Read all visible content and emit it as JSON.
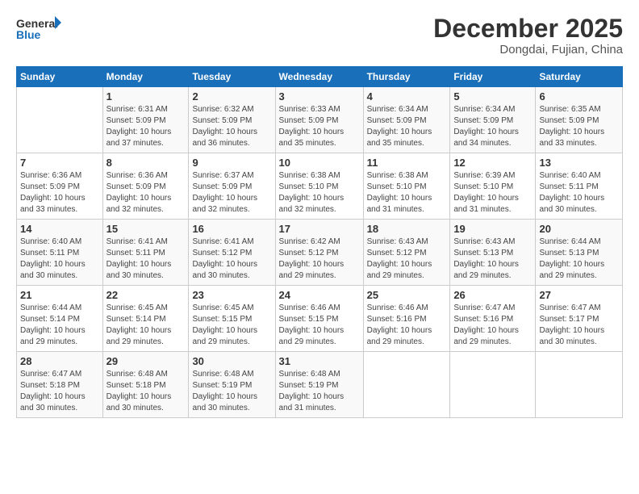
{
  "logo": {
    "line1": "General",
    "line2": "Blue"
  },
  "title": "December 2025",
  "location": "Dongdai, Fujian, China",
  "days_header": [
    "Sunday",
    "Monday",
    "Tuesday",
    "Wednesday",
    "Thursday",
    "Friday",
    "Saturday"
  ],
  "weeks": [
    [
      {
        "num": "",
        "info": ""
      },
      {
        "num": "1",
        "info": "Sunrise: 6:31 AM\nSunset: 5:09 PM\nDaylight: 10 hours\nand 37 minutes."
      },
      {
        "num": "2",
        "info": "Sunrise: 6:32 AM\nSunset: 5:09 PM\nDaylight: 10 hours\nand 36 minutes."
      },
      {
        "num": "3",
        "info": "Sunrise: 6:33 AM\nSunset: 5:09 PM\nDaylight: 10 hours\nand 35 minutes."
      },
      {
        "num": "4",
        "info": "Sunrise: 6:34 AM\nSunset: 5:09 PM\nDaylight: 10 hours\nand 35 minutes."
      },
      {
        "num": "5",
        "info": "Sunrise: 6:34 AM\nSunset: 5:09 PM\nDaylight: 10 hours\nand 34 minutes."
      },
      {
        "num": "6",
        "info": "Sunrise: 6:35 AM\nSunset: 5:09 PM\nDaylight: 10 hours\nand 33 minutes."
      }
    ],
    [
      {
        "num": "7",
        "info": "Sunrise: 6:36 AM\nSunset: 5:09 PM\nDaylight: 10 hours\nand 33 minutes."
      },
      {
        "num": "8",
        "info": "Sunrise: 6:36 AM\nSunset: 5:09 PM\nDaylight: 10 hours\nand 32 minutes."
      },
      {
        "num": "9",
        "info": "Sunrise: 6:37 AM\nSunset: 5:09 PM\nDaylight: 10 hours\nand 32 minutes."
      },
      {
        "num": "10",
        "info": "Sunrise: 6:38 AM\nSunset: 5:10 PM\nDaylight: 10 hours\nand 32 minutes."
      },
      {
        "num": "11",
        "info": "Sunrise: 6:38 AM\nSunset: 5:10 PM\nDaylight: 10 hours\nand 31 minutes."
      },
      {
        "num": "12",
        "info": "Sunrise: 6:39 AM\nSunset: 5:10 PM\nDaylight: 10 hours\nand 31 minutes."
      },
      {
        "num": "13",
        "info": "Sunrise: 6:40 AM\nSunset: 5:11 PM\nDaylight: 10 hours\nand 30 minutes."
      }
    ],
    [
      {
        "num": "14",
        "info": "Sunrise: 6:40 AM\nSunset: 5:11 PM\nDaylight: 10 hours\nand 30 minutes."
      },
      {
        "num": "15",
        "info": "Sunrise: 6:41 AM\nSunset: 5:11 PM\nDaylight: 10 hours\nand 30 minutes."
      },
      {
        "num": "16",
        "info": "Sunrise: 6:41 AM\nSunset: 5:12 PM\nDaylight: 10 hours\nand 30 minutes."
      },
      {
        "num": "17",
        "info": "Sunrise: 6:42 AM\nSunset: 5:12 PM\nDaylight: 10 hours\nand 29 minutes."
      },
      {
        "num": "18",
        "info": "Sunrise: 6:43 AM\nSunset: 5:12 PM\nDaylight: 10 hours\nand 29 minutes."
      },
      {
        "num": "19",
        "info": "Sunrise: 6:43 AM\nSunset: 5:13 PM\nDaylight: 10 hours\nand 29 minutes."
      },
      {
        "num": "20",
        "info": "Sunrise: 6:44 AM\nSunset: 5:13 PM\nDaylight: 10 hours\nand 29 minutes."
      }
    ],
    [
      {
        "num": "21",
        "info": "Sunrise: 6:44 AM\nSunset: 5:14 PM\nDaylight: 10 hours\nand 29 minutes."
      },
      {
        "num": "22",
        "info": "Sunrise: 6:45 AM\nSunset: 5:14 PM\nDaylight: 10 hours\nand 29 minutes."
      },
      {
        "num": "23",
        "info": "Sunrise: 6:45 AM\nSunset: 5:15 PM\nDaylight: 10 hours\nand 29 minutes."
      },
      {
        "num": "24",
        "info": "Sunrise: 6:46 AM\nSunset: 5:15 PM\nDaylight: 10 hours\nand 29 minutes."
      },
      {
        "num": "25",
        "info": "Sunrise: 6:46 AM\nSunset: 5:16 PM\nDaylight: 10 hours\nand 29 minutes."
      },
      {
        "num": "26",
        "info": "Sunrise: 6:47 AM\nSunset: 5:16 PM\nDaylight: 10 hours\nand 29 minutes."
      },
      {
        "num": "27",
        "info": "Sunrise: 6:47 AM\nSunset: 5:17 PM\nDaylight: 10 hours\nand 30 minutes."
      }
    ],
    [
      {
        "num": "28",
        "info": "Sunrise: 6:47 AM\nSunset: 5:18 PM\nDaylight: 10 hours\nand 30 minutes."
      },
      {
        "num": "29",
        "info": "Sunrise: 6:48 AM\nSunset: 5:18 PM\nDaylight: 10 hours\nand 30 minutes."
      },
      {
        "num": "30",
        "info": "Sunrise: 6:48 AM\nSunset: 5:19 PM\nDaylight: 10 hours\nand 30 minutes."
      },
      {
        "num": "31",
        "info": "Sunrise: 6:48 AM\nSunset: 5:19 PM\nDaylight: 10 hours\nand 31 minutes."
      },
      {
        "num": "",
        "info": ""
      },
      {
        "num": "",
        "info": ""
      },
      {
        "num": "",
        "info": ""
      }
    ]
  ]
}
